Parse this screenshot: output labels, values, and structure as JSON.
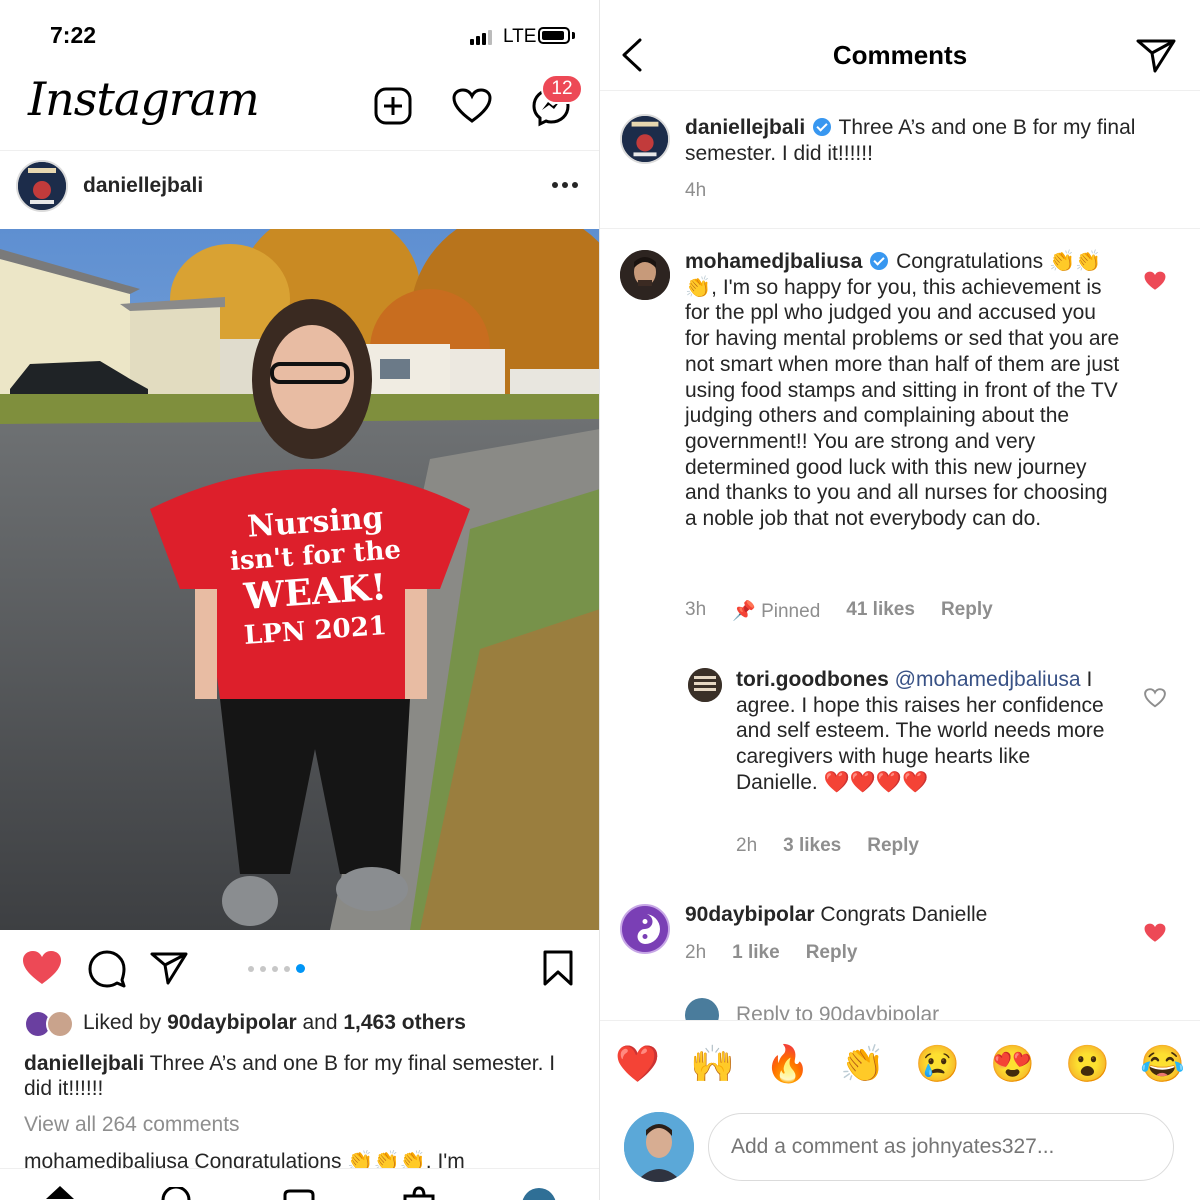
{
  "status": {
    "time": "7:22",
    "network": "LTE"
  },
  "header": {
    "logo": "Instagram",
    "messages_badge": "12"
  },
  "post": {
    "author": "daniellejbali",
    "liked_by": {
      "prefix": "Liked by",
      "user": "90daybipolar",
      "mid": "and",
      "others": "1,463 others"
    },
    "caption_text": "Three A’s and one B for my final semester. I did it!!!!!!",
    "view_all": "View all 264 comments",
    "preview": "mohamedjbaliusa Congratulations 👏👏👏, I'm",
    "carousel": {
      "count": 5,
      "active": 4
    }
  },
  "comments_page": {
    "title": "Comments",
    "original": {
      "user": "daniellejbali",
      "text": "Three A’s and one B for my final semester. I did it!!!!!!",
      "time": "4h"
    },
    "comments": [
      {
        "user": "mohamedjbaliusa",
        "text": "Congratulations 👏👏👏, I'm so happy for you, this achievement is for the ppl who judged you and accused you for having mental problems or sed that you are not smart when more than half of them are just using food stamps and sitting in front of the TV judging others and complaining about the government!! You are strong and very determined good luck with this new journey and thanks to you and all nurses for choosing a noble job that not everybody can do.",
        "time": "3h",
        "pinned": "Pinned",
        "likes": "41 likes",
        "reply": "Reply"
      },
      {
        "user": "tori.goodbones",
        "mention": "@mohamedjbaliusa",
        "text": "I agree. I hope this raises her confidence and self esteem. The world needs more caregivers with huge hearts like Danielle. ❤️❤️❤️❤️",
        "time": "2h",
        "likes": "3 likes",
        "reply": "Reply"
      },
      {
        "user": "90daybipolar",
        "text": "Congrats Danielle",
        "time": "2h",
        "likes": "1 like",
        "reply": "Reply"
      }
    ],
    "reply_to": "Reply to 90daybipolar",
    "emojis": [
      "❤️",
      "🙌",
      "🔥",
      "👏",
      "😢",
      "😍",
      "😮",
      "😂"
    ],
    "input_placeholder": "Add a comment as johnyates327..."
  },
  "shirt": {
    "line1": "Nursing",
    "line2": "isn't for the",
    "line3": "WEAK!",
    "line4": "LPN 2021"
  }
}
